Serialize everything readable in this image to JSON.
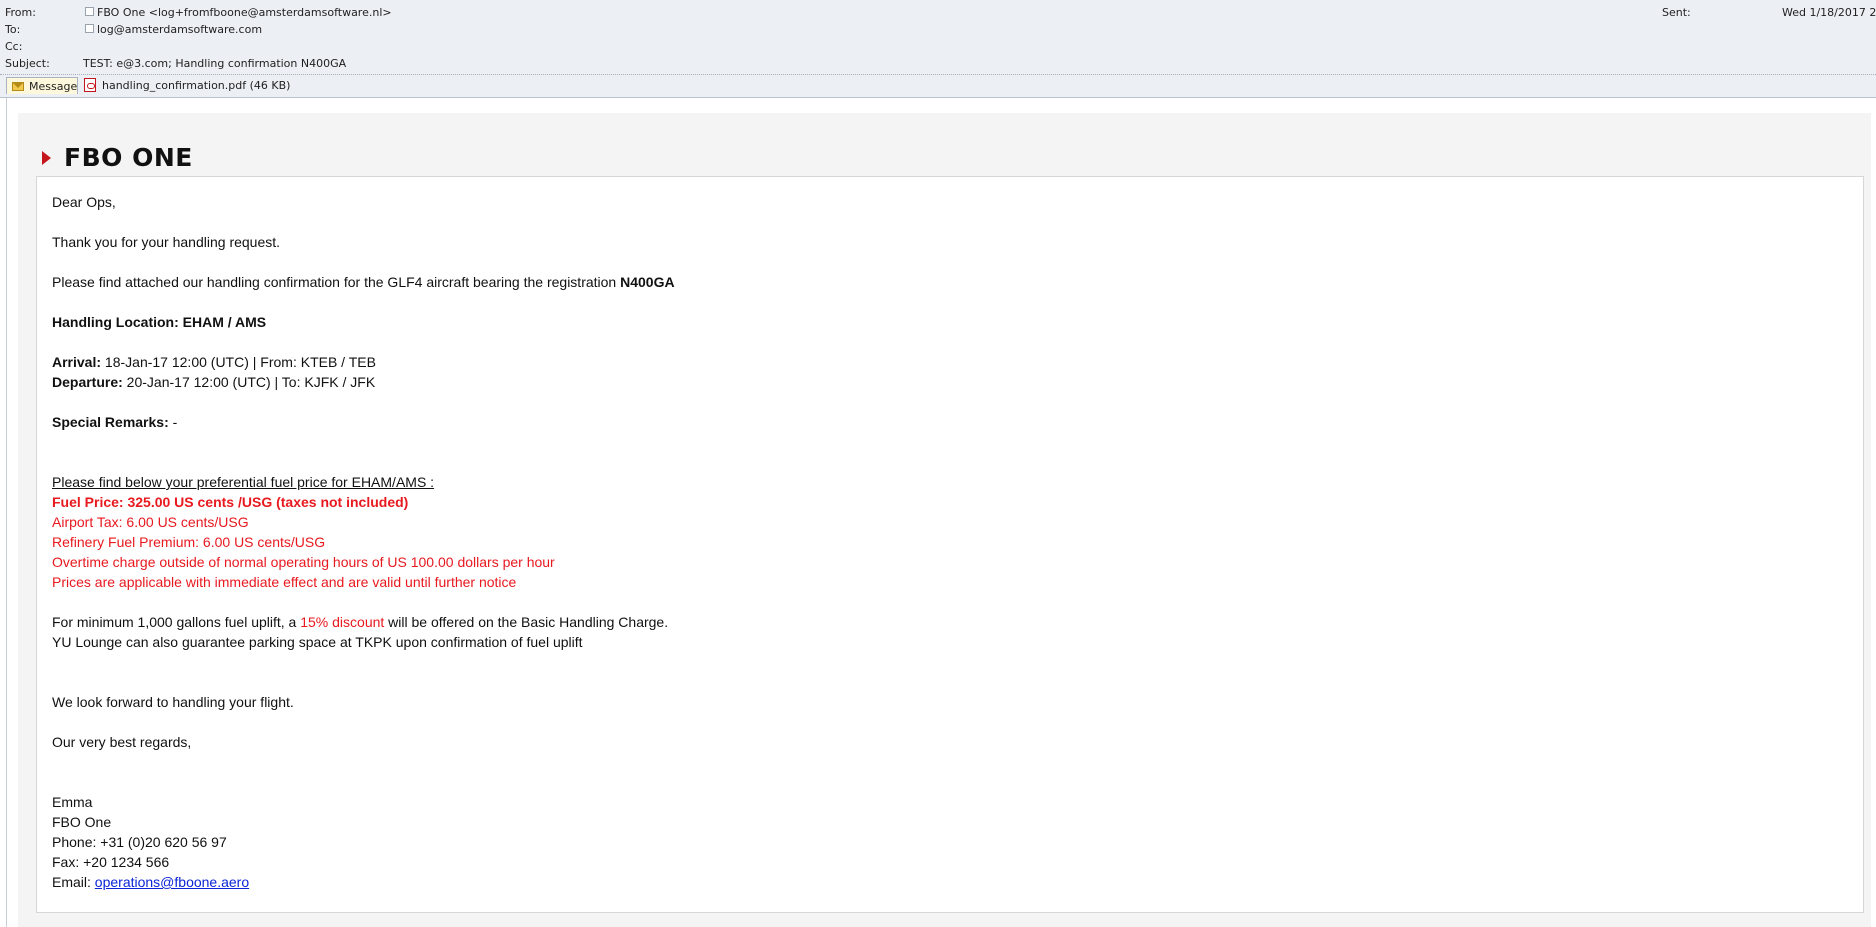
{
  "header": {
    "from_label": "From:",
    "from_value": "FBO One <log+fromfboone@amsterdamsoftware.nl>",
    "to_label": "To:",
    "to_value": "log@amsterdamsoftware.com",
    "cc_label": "Cc:",
    "cc_value": "",
    "subject_label": "Subject:",
    "subject_value": "TEST: e@3.com; Handling confirmation N400GA",
    "sent_label": "Sent:",
    "sent_value": "Wed 1/18/2017 2"
  },
  "attachments": {
    "message_tab": "Message",
    "file": "handling_confirmation.pdf (46 KB)",
    "file_icon": "pdf-icon",
    "message_icon": "envelope-icon"
  },
  "brand": {
    "name": "FBO ONE",
    "accent_color": "#c4161c"
  },
  "body": {
    "greeting": "Dear Ops,",
    "thanks": "Thank you for your handling request.",
    "attached_prefix": "Please find attached our handling confirmation for the GLF4 aircraft bearing the registration ",
    "registration": "N400GA",
    "handling_location": "Handling Location: EHAM / AMS",
    "arrival_label": "Arrival:",
    "arrival_value": " 18-Jan-17 12:00 (UTC) | From: KTEB / TEB",
    "departure_label": "Departure:",
    "departure_value": " 20-Jan-17 12:00 (UTC) | To: KJFK / JFK",
    "remarks_label": "Special Remarks:",
    "remarks_value": " -",
    "fuel_intro": "Please find below your preferential fuel price for EHAM/AMS :",
    "fuel_price": "Fuel Price: 325.00 US cents /USG (taxes not included)",
    "airport_tax": "Airport Tax: 6.00 US cents/USG",
    "refinery": "Refinery Fuel Premium: 6.00 US cents/USG",
    "overtime": "Overtime charge outside of normal operating hours of US 100.00 dollars per hour",
    "validity": "Prices are applicable with immediate effect and are valid until further notice",
    "discount_prefix": "For minimum 1,000 gallons fuel uplift, a ",
    "discount_highlight": "15% discount",
    "discount_suffix": " will be offered on the Basic Handling Charge.",
    "lounge": "YU Lounge can also guarantee parking space at TKPK upon confirmation of fuel uplift",
    "look_forward": "We look forward to handling your flight.",
    "regards": "Our very best regards,",
    "sig_name": "Emma",
    "sig_company": "FBO One",
    "sig_phone": "Phone: +31 (0)20 620 56 97",
    "sig_fax": "Fax: +20 1234 566",
    "sig_email_label": "Email: ",
    "sig_email": "operations@fboone.aero",
    "price_color": "#e8191f",
    "link_color": "#0b24d6"
  }
}
